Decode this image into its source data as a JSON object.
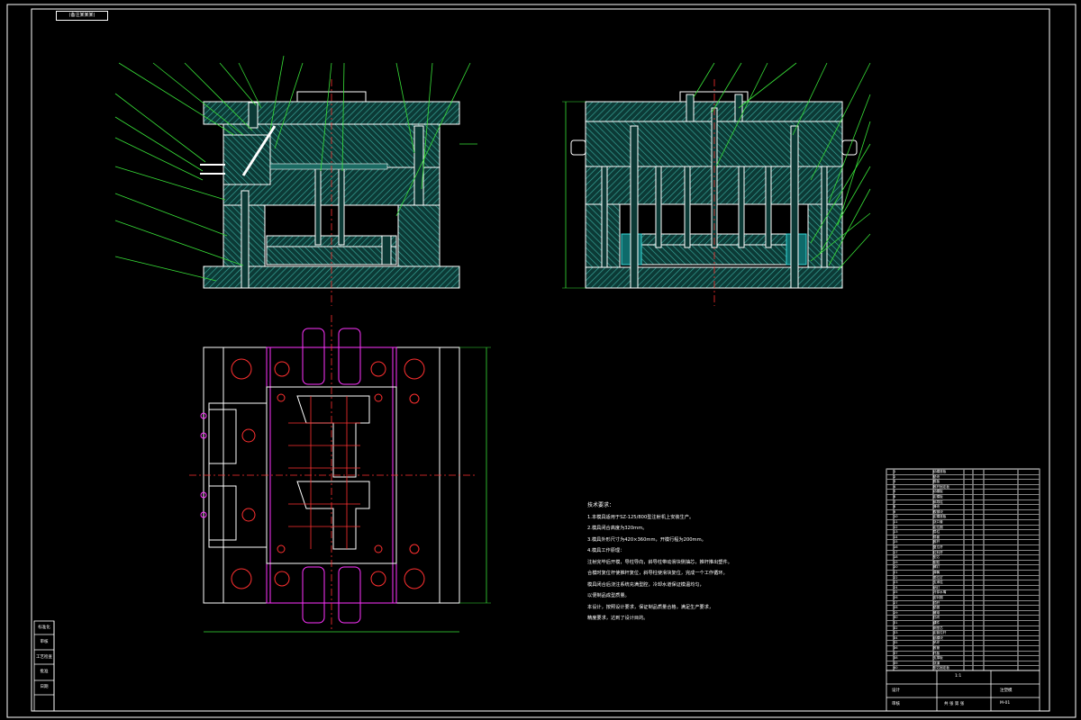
{
  "stamp": "(备注某某某)",
  "notes": {
    "title": "技术要求：",
    "lines": [
      "1.本模具适用于SZ-125/800型注射机上安装生产。",
      "2.模具闭合高度为320mm。",
      "3.模具外形尺寸为420×360mm，开模行程为200mm。",
      "4.模具工作原理：",
      "注射完毕后开模，导柱导向，斜导柱带动滑块侧抽芯，推杆推出塑件。",
      "合模时复位杆使推杆复位，斜导柱使滑块复位，完成一个工作循环。",
      "模具闭合后浇注系统充满型腔，冷却水道保证模温均匀，",
      "以便制品成型质量。",
      "   本设计，按照设计要求，保证制品质量合格，满足生产要求，",
      "精度要求，达到了设计目的。"
    ]
  },
  "side_labels": [
    "标准化",
    "审核",
    "工艺检查",
    "批准",
    "日期"
  ],
  "title_block": {
    "drawing_name": "注塑模",
    "drawing_no": "M-01",
    "scale": "1:1",
    "sheet": "共 张 第 张",
    "design": "设计",
    "check": "审核"
  },
  "bom_rows": [
    [
      "1",
      "动模座板"
    ],
    [
      "2",
      "垫块"
    ],
    [
      "3",
      "推板"
    ],
    [
      "4",
      "推杆固定板"
    ],
    [
      "5",
      "动模板"
    ],
    [
      "6",
      "定模板"
    ],
    [
      "7",
      "斜导柱"
    ],
    [
      "8",
      "滑块"
    ],
    [
      "9",
      "楔紧块"
    ],
    [
      "10",
      "定模座板"
    ],
    [
      "11",
      "浇口套"
    ],
    [
      "12",
      "定位圈"
    ],
    [
      "13",
      "导柱"
    ],
    [
      "14",
      "导套"
    ],
    [
      "15",
      "推杆"
    ],
    [
      "16",
      "复位杆"
    ],
    [
      "17",
      "拉料杆"
    ],
    [
      "18",
      "型芯"
    ],
    [
      "19",
      "型腔"
    ],
    [
      "20",
      "螺钉"
    ],
    [
      "21",
      "弹簧"
    ],
    [
      "22",
      "限位钉"
    ],
    [
      "23",
      "支承柱"
    ],
    [
      "24",
      "销钉"
    ],
    [
      "25",
      "冷却水嘴"
    ],
    [
      "26",
      "密封圈"
    ],
    [
      "27",
      "顶杆"
    ],
    [
      "28",
      "垫圈"
    ],
    [
      "29",
      "螺母"
    ],
    [
      "30",
      "挡块"
    ],
    [
      "31",
      "镶件"
    ],
    [
      "32",
      "侧型芯"
    ],
    [
      "33",
      "定距拉杆"
    ],
    [
      "34",
      "锁模块"
    ],
    [
      "35",
      "吊环"
    ],
    [
      "36",
      "推管"
    ],
    [
      "37",
      "托板"
    ],
    [
      "38",
      "支撑板"
    ],
    [
      "39",
      "浇道"
    ],
    [
      "40",
      "型芯固定板"
    ]
  ],
  "colors": {
    "outline": "#ffffff",
    "plate": "#2f9f96",
    "centerline": "#ff3030",
    "leader": "#38e038",
    "magenta": "#ff33ff",
    "cyan": "#38d8d8",
    "dim": "#38e038"
  }
}
